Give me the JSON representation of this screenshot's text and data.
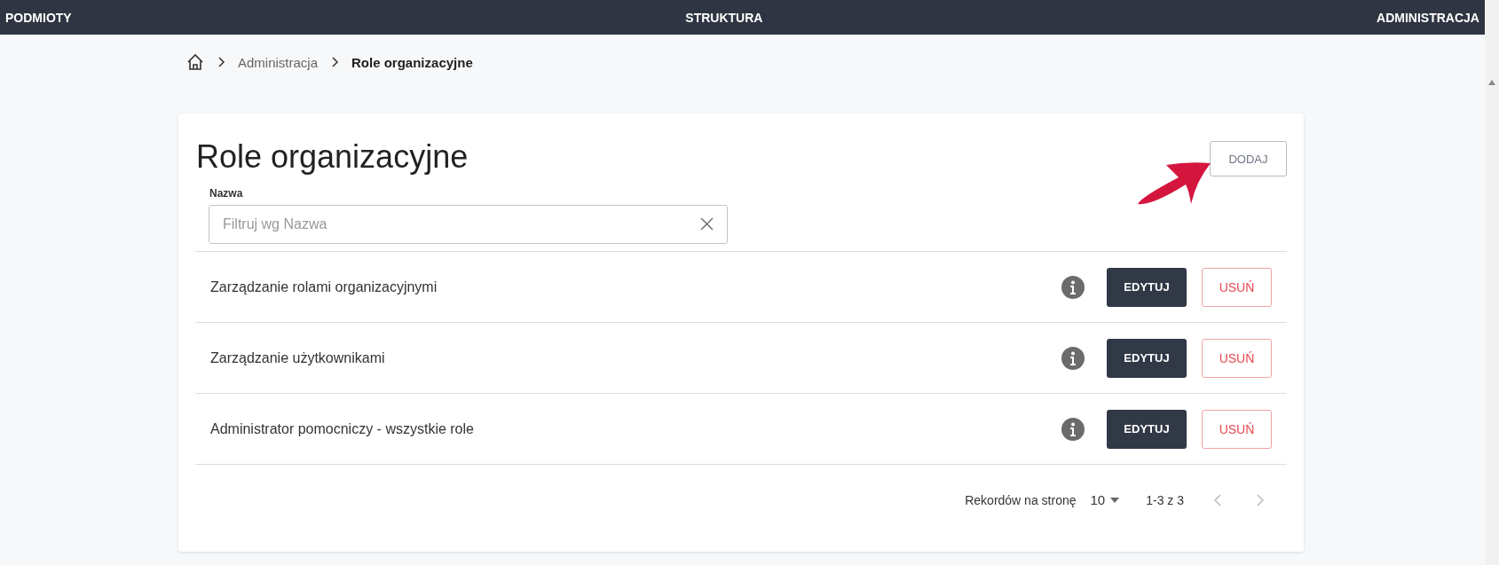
{
  "top_nav": [
    {
      "label": "PODMIOTY"
    },
    {
      "label": "STRUKTURA"
    },
    {
      "label": "ADMINISTRACJA"
    }
  ],
  "breadcrumb": [
    {
      "label": "Administracja",
      "current": false
    },
    {
      "label": "Role organizacyjne",
      "current": true
    }
  ],
  "page_title": "Role organizacyjne",
  "add_button": "DODAJ",
  "filter": {
    "label": "Nazwa",
    "placeholder": "Filtruj wg Nazwa"
  },
  "rows": [
    {
      "name": "Zarządzanie rolami organizacyjnymi",
      "edit": "EDYTUJ",
      "delete": "USUŃ"
    },
    {
      "name": "Zarządzanie użytkownikami",
      "edit": "EDYTUJ",
      "delete": "USUŃ"
    },
    {
      "name": "Administrator pomocniczy - wszystkie role",
      "edit": "EDYTUJ",
      "delete": "USUŃ"
    }
  ],
  "pagination": {
    "rows_per_page_label": "Rekordów na stronę",
    "rows_per_page": "10",
    "range": "1-3 z 3",
    "prev_disabled": true,
    "next_disabled": true
  }
}
